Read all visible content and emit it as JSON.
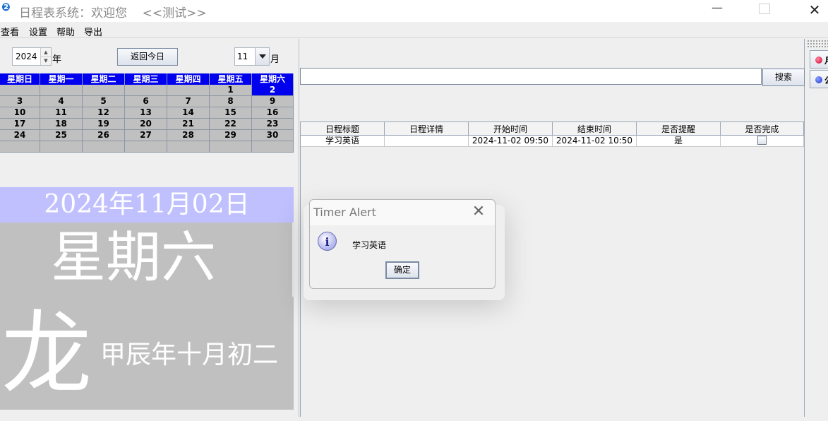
{
  "window": {
    "title": "日程表系统：欢迎您    <<测试>>",
    "icon": "app-logo-icon",
    "controls": [
      "minimize",
      "maximize",
      "close"
    ]
  },
  "menu": [
    "查看",
    "设置",
    "帮助",
    "导出"
  ],
  "date_picker": {
    "year": "2024",
    "year_label": "年",
    "today_button": "返回今日",
    "month": "11",
    "month_label": "月"
  },
  "calendar": {
    "weekdays": [
      "星期日",
      "星期一",
      "星期二",
      "星期三",
      "星期四",
      "星期五",
      "星期六"
    ],
    "rows": [
      [
        "",
        "",
        "",
        "",
        "",
        "1",
        "2"
      ],
      [
        "3",
        "4",
        "5",
        "6",
        "7",
        "8",
        "9"
      ],
      [
        "10",
        "11",
        "12",
        "13",
        "14",
        "15",
        "16"
      ],
      [
        "17",
        "18",
        "19",
        "20",
        "21",
        "22",
        "23"
      ],
      [
        "24",
        "25",
        "26",
        "27",
        "28",
        "29",
        "30"
      ],
      [
        "",
        "",
        "",
        "",
        "",
        "",
        ""
      ]
    ],
    "selected_day": "2",
    "selected_color": "#0000ee"
  },
  "day_info": {
    "date": "2024年11月02日",
    "weekday": "星期六",
    "zodiac": "龙",
    "lunar": "甲辰年十月初二",
    "banner_color": "#c0c0ff",
    "panel_color": "#c0c0c0"
  },
  "search": {
    "value": "",
    "button": "搜索"
  },
  "table": {
    "headers": [
      "日程标题",
      "日程详情",
      "开始时间",
      "结束时间",
      "是否提醒",
      "是否完成"
    ],
    "rows": [
      {
        "title": "学习英语",
        "detail": "",
        "start": "2024-11-02 09:50",
        "end": "2024-11-02 10:50",
        "remind": "是",
        "done": false
      }
    ]
  },
  "side_buttons": [
    {
      "label": "月",
      "dot_color": "#cc0033"
    },
    {
      "label": "公",
      "dot_color": "#1a33cc"
    }
  ],
  "dialog": {
    "title": "Timer Alert",
    "icon": "info-icon",
    "message": "学习英语",
    "ok": "确定"
  }
}
